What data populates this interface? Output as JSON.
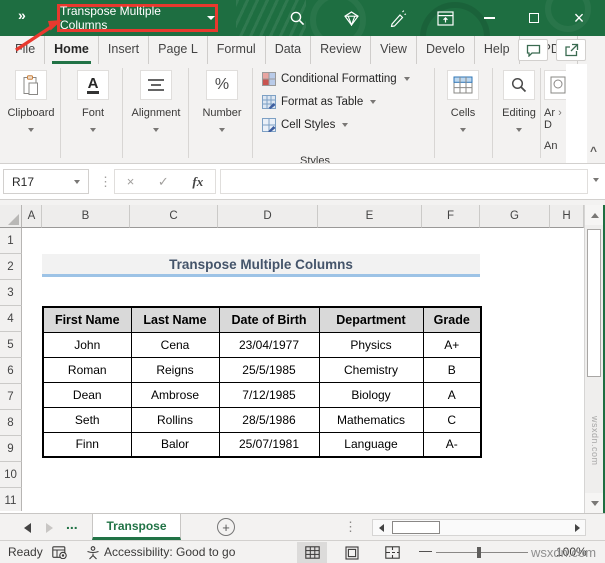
{
  "title_bar": {
    "workbook_title": "Transpose Multiple Columns"
  },
  "ribbon": {
    "tabs": [
      "File",
      "Home",
      "Insert",
      "Page L",
      "Formul",
      "Data",
      "Review",
      "View",
      "Develo",
      "Help",
      "doPDF"
    ],
    "active_tab": "Home",
    "groups": {
      "clipboard": {
        "label": "Clipboard"
      },
      "font": {
        "label": "Font",
        "icon_letter": "A"
      },
      "alignment": {
        "label": "Alignment"
      },
      "number": {
        "label": "Number",
        "icon_text": "%"
      },
      "styles": {
        "label": "Styles",
        "buttons": [
          "Conditional Formatting",
          "Format as Table",
          "Cell Styles"
        ]
      },
      "cells": {
        "label": "Cells"
      },
      "editing": {
        "label": "Editing"
      },
      "analyze_partial": {
        "line1": "Ar",
        "line2": "D",
        "label": "An"
      }
    }
  },
  "formula_bar": {
    "name_box": "R17",
    "fx_label": "fx"
  },
  "grid": {
    "column_headers": [
      "A",
      "B",
      "C",
      "D",
      "E",
      "F",
      "G",
      "H"
    ],
    "row_numbers": [
      "1",
      "2",
      "3",
      "4",
      "5",
      "6",
      "7",
      "8",
      "9",
      "10",
      "11"
    ],
    "banner_text": "Transpose Multiple Columns",
    "table": {
      "headers": [
        "First Name",
        "Last Name",
        "Date of Birth",
        "Department",
        "Grade"
      ],
      "rows": [
        [
          "John",
          "Cena",
          "23/04/1977",
          "Physics",
          "A+"
        ],
        [
          "Roman",
          "Reigns",
          "25/5/1985",
          "Chemistry",
          "B"
        ],
        [
          "Dean",
          "Ambrose",
          "7/12/1985",
          "Biology",
          "A"
        ],
        [
          "Seth",
          "Rollins",
          "28/5/1986",
          "Mathematics",
          "C"
        ],
        [
          "Finn",
          "Balor",
          "25/07/1981",
          "Language",
          "A-"
        ]
      ]
    }
  },
  "sheet_tabs": {
    "more_glyph": "...",
    "active_sheet": "Transpose"
  },
  "status_bar": {
    "ready": "Ready",
    "accessibility": "Accessibility: Good to go",
    "zoom_level": "100%"
  },
  "watermark": "wsxdn.com",
  "glyphs": {
    "overflow": "»",
    "close": "×",
    "cancel": "×",
    "check": "✓",
    "dots": "⋮",
    "plus": "+",
    "percent": "%",
    "collapse": "^",
    "chevron_right": "›",
    "minus": "—"
  },
  "colors": {
    "excel_green": "#217346",
    "titlebar_green": "#1e6e41",
    "annotation_red": "#e8392e",
    "banner_text": "#44546a",
    "banner_border": "#9dc3e6",
    "table_header_bg": "#d9d9d9"
  }
}
